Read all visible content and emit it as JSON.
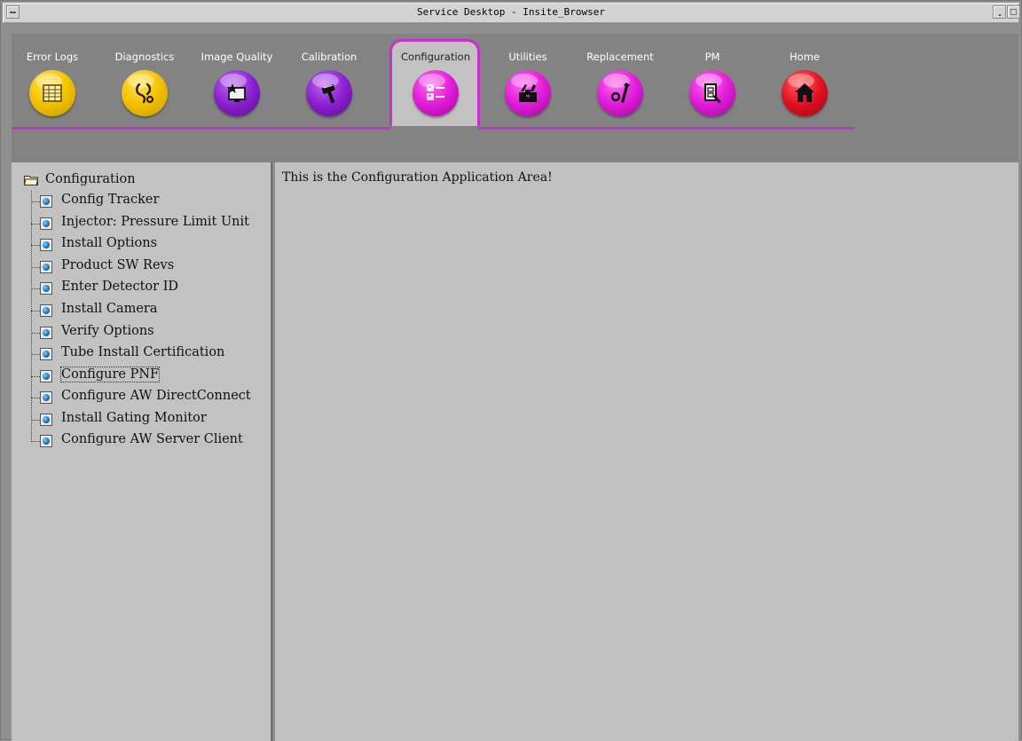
{
  "window": {
    "title": "Service Desktop - Insite_Browser"
  },
  "toolbar": {
    "tabs": [
      {
        "label": "Error Logs",
        "icon": "log-table-icon",
        "color": "#f4c400"
      },
      {
        "label": "Diagnostics",
        "icon": "stethoscope-icon",
        "color": "#f4c400"
      },
      {
        "label": "Image Quality",
        "icon": "monitor-star-icon",
        "color": "#8a1fd0"
      },
      {
        "label": "Calibration",
        "icon": "calibration-tool-icon",
        "color": "#8a1fd0"
      },
      {
        "label": "Configuration",
        "icon": "checklist-icon",
        "color": "#e01bd8",
        "active": true
      },
      {
        "label": "Utilities",
        "icon": "toolbox-icon",
        "color": "#e01bd8"
      },
      {
        "label": "Replacement",
        "icon": "wrench-icon",
        "color": "#e01bd8"
      },
      {
        "label": "PM",
        "icon": "pm-document-wrench-icon",
        "color": "#e01bd8"
      },
      {
        "label": "Home",
        "icon": "home-icon",
        "color": "#e01020"
      }
    ],
    "active_accent": "#c72fd0"
  },
  "nav": {
    "root": {
      "label": "Configuration",
      "icon": "folder-open-icon"
    },
    "items": [
      {
        "label": "Config Tracker"
      },
      {
        "label": "Injector: Pressure Limit Unit"
      },
      {
        "label": "Install Options"
      },
      {
        "label": "Product SW Revs"
      },
      {
        "label": "Enter Detector ID"
      },
      {
        "label": "Install Camera"
      },
      {
        "label": "Verify Options"
      },
      {
        "label": "Tube Install Certification"
      },
      {
        "label": "Configure PNF",
        "selected": true
      },
      {
        "label": "Configure AW DirectConnect"
      },
      {
        "label": "Install Gating Monitor"
      },
      {
        "label": "Configure AW Server Client"
      }
    ]
  },
  "main": {
    "message": "This is the Configuration Application Area!"
  }
}
